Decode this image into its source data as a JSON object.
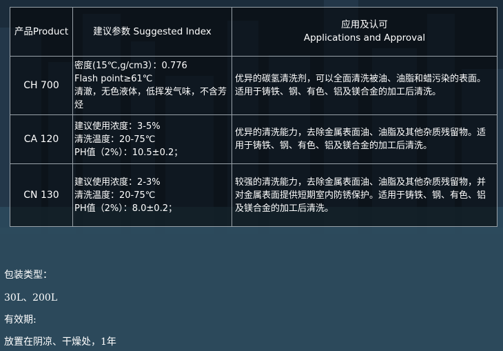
{
  "table": {
    "headers": {
      "product": "产品Product",
      "params": "建议参数  Suggested Index",
      "apps_cn": "应用及认可",
      "apps_en": "Applications and Approval"
    },
    "rows": [
      {
        "product": "CH 700",
        "params": [
          "密度(15℃,g/cm3）：0.776",
          "Flash point≥61℃",
          "清澈，无色液体，低挥发气味，不含芳烃"
        ],
        "desc": "优异的碳氢清洗剂，可以全面清洗被油、油脂和蜡污染的表面。适用于铸铁、钢、有色、铝及镁合金的加工后清洗。"
      },
      {
        "product": "CA 120",
        "params": [
          "建议使用浓度：3-5%",
          "清洗温度：20-75℃",
          "PH值（2%）：10.5±0.2；"
        ],
        "desc": "优异的清洗能力，去除金属表面油、油脂及其他杂质残留物。适用于铸铁、钢、有色、铝及镁合金的加工后清洗。"
      },
      {
        "product": "CN 130",
        "params": [
          "建议使用浓度：2-3%",
          "清洗温度：20-75℃",
          "PH值（2%）：8.0±0.2；"
        ],
        "desc": "较强的清洗能力，去除金属表面油、油脂及其他杂质残留物，并对金属表面提供短期室内防锈保护。适用于铸铁、钢、有色、铝及镁合金的加工后清洗。"
      }
    ]
  },
  "footer": {
    "packaging_label": "包装类型：",
    "packaging_value": "30L、200L",
    "shelf_label": "有效期:",
    "shelf_value": "放置在阴凉、干燥处，1年"
  }
}
